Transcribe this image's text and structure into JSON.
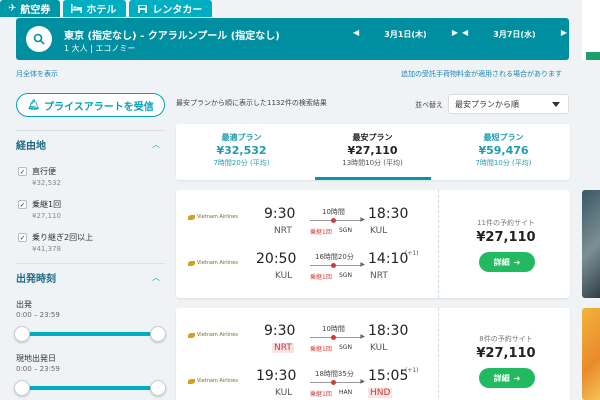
{
  "tabs": [
    {
      "label": "航空券",
      "icon": "airplane-icon",
      "active": true
    },
    {
      "label": "ホテル",
      "icon": "bed-icon",
      "active": false
    },
    {
      "label": "レンタカー",
      "icon": "car-icon",
      "active": false
    }
  ],
  "search": {
    "route": "東京 (指定なし) - クアラルンプール (指定なし)",
    "passengers": "1 大人 | エコノミー",
    "depart_date": "3月1日(木)",
    "return_date": "3月7日(水)"
  },
  "links": {
    "show_month": "月全体を表示",
    "fee_notice": "追加の受託手荷物料金が適用される場合があります"
  },
  "alert_button": "プライスアラートを受信",
  "summary": "最安プランから順に表示した1132件の検索結果",
  "sort": {
    "label": "並べ替え",
    "value": "最安プランから順"
  },
  "filters": {
    "stops_title": "経由地",
    "stops": [
      {
        "label": "直行便",
        "price": "¥32,532",
        "checked": true
      },
      {
        "label": "乗継1回",
        "price": "¥27,110",
        "checked": true
      },
      {
        "label": "乗り継ぎ2回以上",
        "price": "¥41,378",
        "checked": true
      }
    ],
    "depart_title": "出発時刻",
    "depart_label": "出発",
    "depart_range": "0:00 – 23:59",
    "local_label": "現地出発日",
    "local_range": "0:00 – 23:59"
  },
  "plans": [
    {
      "label": "最適プラン",
      "price": "¥32,532",
      "duration": "7時間20分 (平均)"
    },
    {
      "label": "最安プラン",
      "price": "¥27,110",
      "duration": "13時間10分 (平均)"
    },
    {
      "label": "最短プラン",
      "price": "¥59,476",
      "duration": "7時間10分 (平均)"
    }
  ],
  "results": [
    {
      "sites": "11件の予約サイト",
      "price": "¥27,110",
      "button": "詳細",
      "legs": [
        {
          "airline": "Vietnam Airlines",
          "dep_time": "9:30",
          "dep_code": "NRT",
          "duration": "10時間",
          "stops": "乗継1回",
          "via": "SGN",
          "arr_time": "18:30",
          "arr_code": "KUL",
          "plus": ""
        },
        {
          "airline": "Vietnam Airlines",
          "dep_time": "20:50",
          "dep_code": "KUL",
          "duration": "16時間20分",
          "stops": "乗継1回",
          "via": "SGN",
          "arr_time": "14:10",
          "arr_code": "NRT",
          "plus": "(+1)"
        }
      ]
    },
    {
      "sites": "8件の予約サイト",
      "price": "¥27,110",
      "button": "詳細",
      "legs": [
        {
          "airline": "Vietnam Airlines",
          "dep_time": "9:30",
          "dep_code": "NRT",
          "duration": "10時間",
          "stops": "乗継1回",
          "via": "SGN",
          "arr_time": "18:30",
          "arr_code": "KUL",
          "plus": ""
        },
        {
          "airline": "Vietnam Airlines",
          "dep_time": "19:30",
          "dep_code": "KUL",
          "duration": "18時間35分",
          "stops": "乗継1回",
          "via": "HAN",
          "arr_time": "15:05",
          "arr_code": "HND",
          "plus": "(+1)"
        }
      ]
    }
  ],
  "colors": {
    "brand": "#00aec2",
    "search_bg": "#008fa1",
    "button_green": "#21ba61",
    "stop_red": "#d23b3b"
  }
}
